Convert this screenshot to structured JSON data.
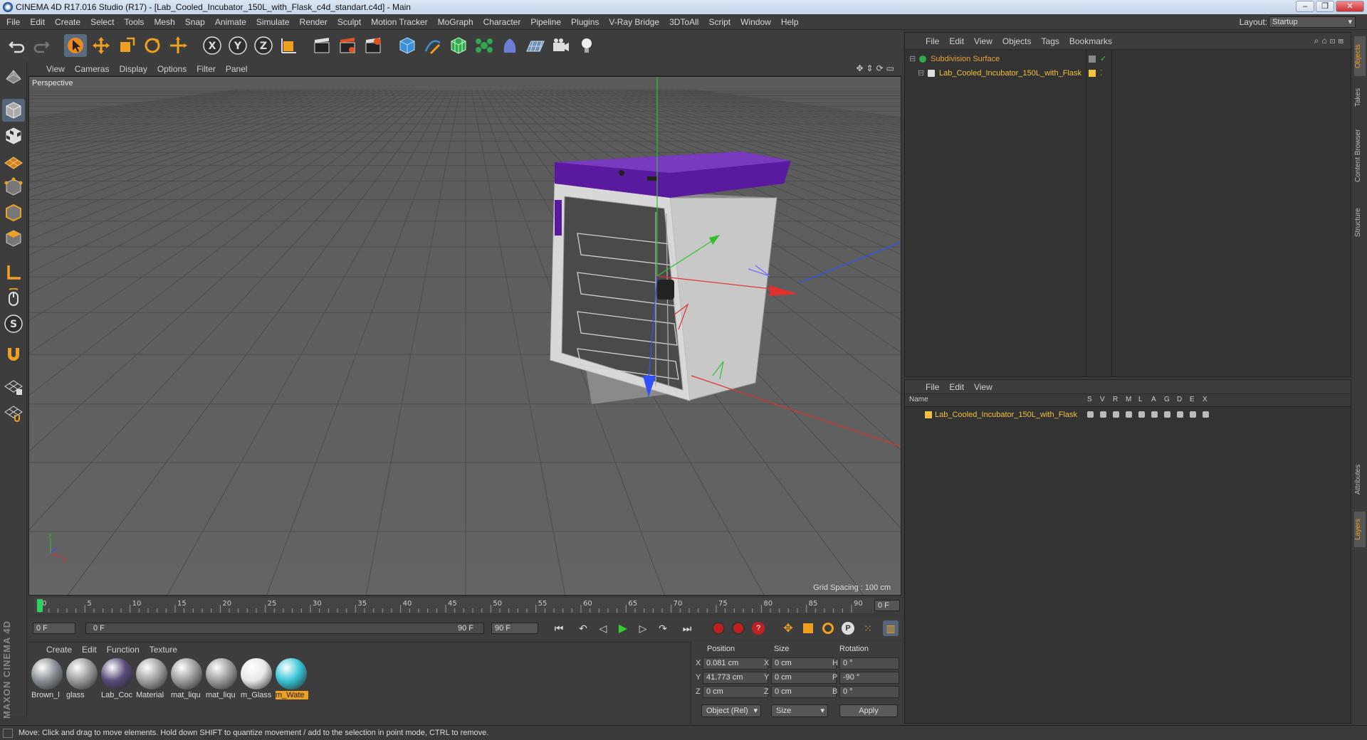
{
  "window": {
    "title": "CINEMA 4D R17.016 Studio (R17) - [Lab_Cooled_Incubator_150L_with_Flask_c4d_standart.c4d] - Main",
    "minimize": "–",
    "maximize": "❐",
    "close": "✕"
  },
  "menu": [
    "File",
    "Edit",
    "Create",
    "Select",
    "Tools",
    "Mesh",
    "Snap",
    "Animate",
    "Simulate",
    "Render",
    "Sculpt",
    "Motion Tracker",
    "MoGraph",
    "Character",
    "Pipeline",
    "Plugins",
    "V-Ray Bridge",
    "3DToAll",
    "Script",
    "Window",
    "Help"
  ],
  "layout": {
    "label": "Layout:",
    "value": "Startup"
  },
  "viewport": {
    "menu": [
      "View",
      "Cameras",
      "Display",
      "Options",
      "Filter",
      "Panel"
    ],
    "label": "Perspective",
    "grid_spacing": "Grid Spacing : 100 cm"
  },
  "timeline": {
    "ticks": [
      "0",
      "5",
      "10",
      "15",
      "20",
      "25",
      "30",
      "35",
      "40",
      "45",
      "50",
      "55",
      "60",
      "65",
      "70",
      "75",
      "80",
      "85",
      "90"
    ],
    "end_field": "0 F"
  },
  "playback": {
    "start": "0 F",
    "range_start": "0 F",
    "range_end": "90 F",
    "end": "90 F"
  },
  "materials": {
    "menu": [
      "Create",
      "Edit",
      "Function",
      "Texture"
    ],
    "items": [
      {
        "label": "Brown_l",
        "color": "#8a8f96"
      },
      {
        "label": "glass",
        "color": "#9a9a9a"
      },
      {
        "label": "Lab_Coc",
        "color": "#5a4a7a"
      },
      {
        "label": "Material",
        "color": "#a0a0a0"
      },
      {
        "label": "mat_liqu",
        "color": "#9c9c9c"
      },
      {
        "label": "mat_liqu",
        "color": "#9c9c9c"
      },
      {
        "label": "m_Glass",
        "color": "#e8e8e8"
      },
      {
        "label": "m_Wate",
        "color": "#38c6d6"
      }
    ],
    "selected_index": 7
  },
  "coords": {
    "headers": [
      "Position",
      "Size",
      "Rotation"
    ],
    "rows": [
      {
        "axis": "X",
        "pos": "0.081 cm",
        "size_axis": "X",
        "size": "0 cm",
        "rot_axis": "H",
        "rot": "0 °"
      },
      {
        "axis": "Y",
        "pos": "41.773 cm",
        "size_axis": "Y",
        "size": "0 cm",
        "rot_axis": "P",
        "rot": "-90 °"
      },
      {
        "axis": "Z",
        "pos": "0 cm",
        "size_axis": "Z",
        "size": "0 cm",
        "rot_axis": "B",
        "rot": "0 °"
      }
    ],
    "mode": "Object (Rel)",
    "size_mode": "Size",
    "apply": "Apply"
  },
  "object_manager": {
    "menu": [
      "File",
      "Edit",
      "View",
      "Objects",
      "Tags",
      "Bookmarks"
    ],
    "objects": [
      {
        "name": "Subdivision Surface",
        "color": "#e8a33a"
      },
      {
        "name": "Lab_Cooled_Incubator_150L_with_Flask",
        "color": "#f0c040"
      }
    ]
  },
  "layer_manager": {
    "menu": [
      "File",
      "Edit",
      "View"
    ],
    "columns": [
      "Name",
      "S",
      "V",
      "R",
      "M",
      "L",
      "A",
      "G",
      "D",
      "E",
      "X"
    ],
    "layers": [
      {
        "name": "Lab_Cooled_Incubator_150L_with_Flask",
        "color": "#f0c040"
      }
    ]
  },
  "side_tabs": [
    "Objects",
    "Takes",
    "Content Browser",
    "Structure",
    "Attributes",
    "Layers"
  ],
  "branding": "MAXON CINEMA 4D",
  "status": "Move: Click and drag to move elements. Hold down SHIFT to quantize movement / add to the selection in point mode, CTRL to remove.",
  "colors": {
    "accent": "#f0a020",
    "x_axis": "#e03030",
    "y_axis": "#30c030",
    "z_axis": "#3050ff",
    "lid": "#5a1aa0"
  }
}
